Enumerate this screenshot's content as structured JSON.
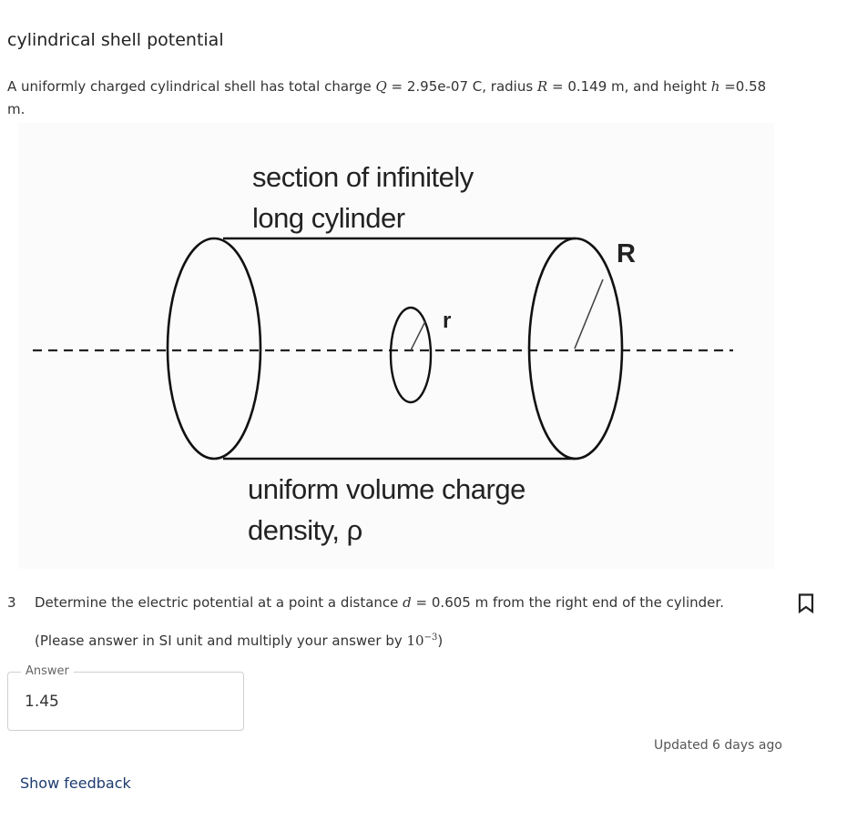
{
  "page": {
    "title": "cylindrical shell potential"
  },
  "intro": {
    "t1": "A uniformly charged cylindrical shell has total charge ",
    "q_var": "Q",
    "t2": " = 2.95e-07 C, radius ",
    "r_var": "R",
    "t3": " = 0.149 m, and height ",
    "h_var": "h",
    "t4": " =0.58 m."
  },
  "figure": {
    "caption_top_line1": "section of infinitely",
    "caption_top_line2": "long cylinder",
    "caption_bottom_line1": "uniform volume charge",
    "caption_bottom_line2": "density, ρ",
    "label_big_radius": "R",
    "label_small_radius": "r"
  },
  "question": {
    "number": "3",
    "t1": "Determine the electric potential at a point a distance ",
    "d_var": "d",
    "t2": " = 0.605 m from the right end of the cylinder.",
    "note_prefix": "(Please answer in SI unit and multiply your answer by ",
    "note_base": "10",
    "note_exp": "−3",
    "note_suffix": ")",
    "bookmark_icon": "bookmark-outline-icon"
  },
  "answer": {
    "label": "Answer",
    "value": "1.45"
  },
  "footer": {
    "updated": "Updated 6 days ago",
    "feedback_link": "Show feedback"
  }
}
